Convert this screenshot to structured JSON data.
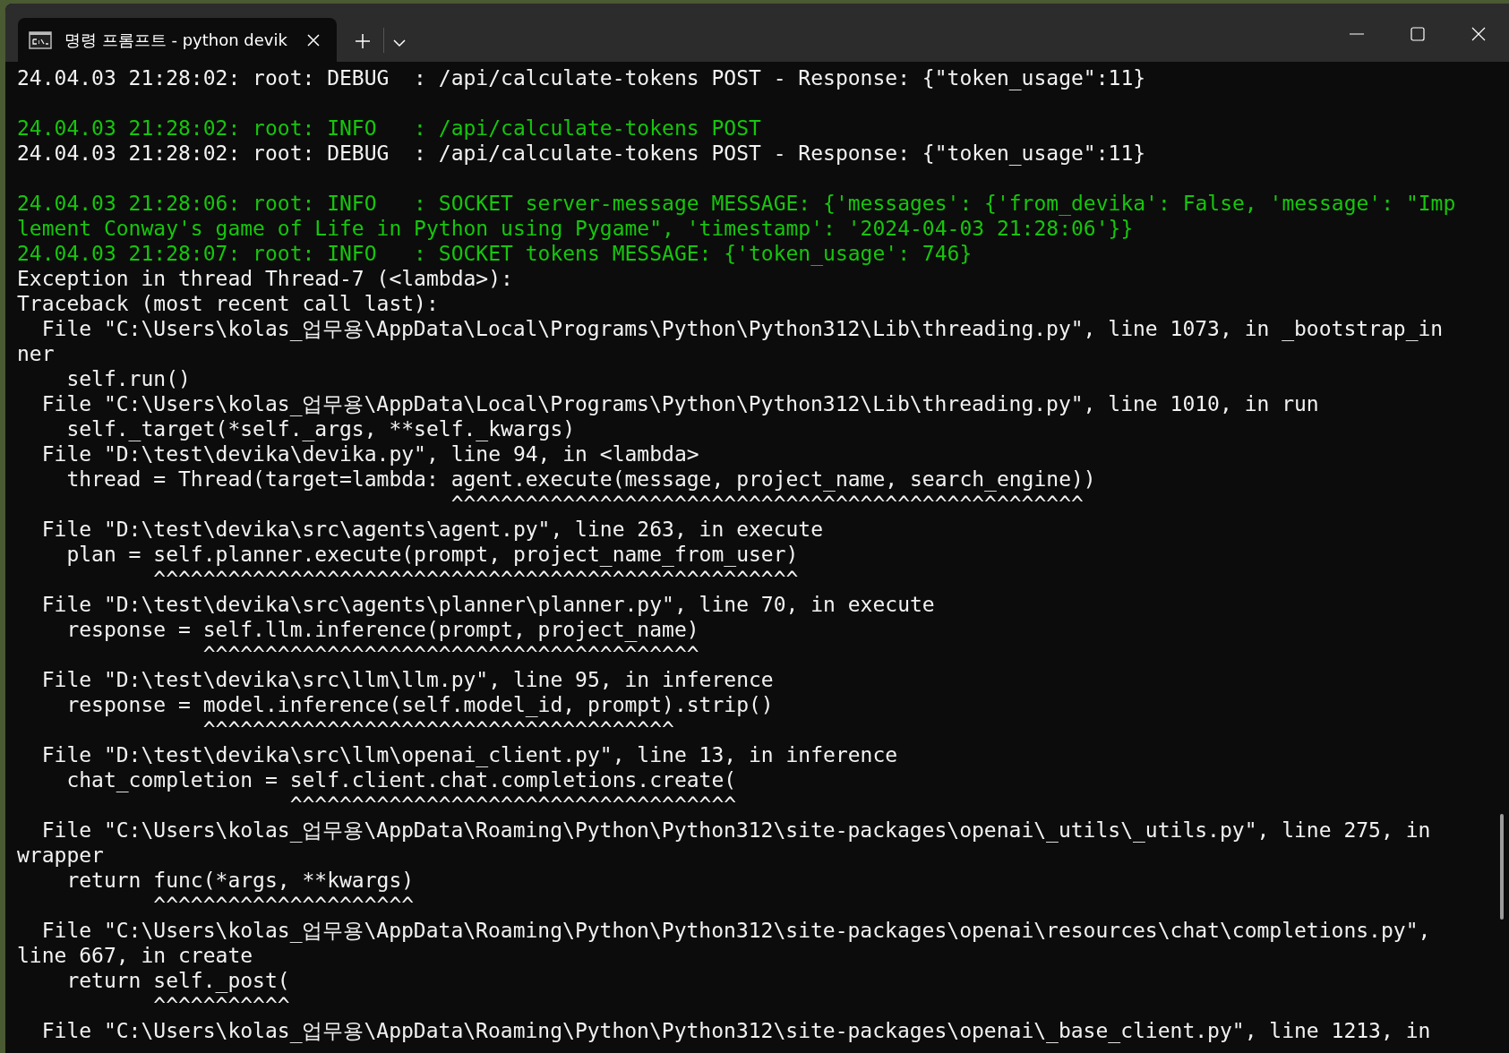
{
  "tab": {
    "title": "명령 프롬프트 - python  devik",
    "selected": true
  },
  "lines": [
    {
      "kind": "text",
      "color": "#f2f2f2",
      "text": "24.04.03 21:28:02: root: DEBUG  : /api/calculate-tokens POST - Response: {\"token_usage\":11}"
    },
    {
      "kind": "blank"
    },
    {
      "kind": "text",
      "color": "#16c60c",
      "text": "24.04.03 21:28:02: root: INFO   : /api/calculate-tokens POST"
    },
    {
      "kind": "text",
      "color": "#f2f2f2",
      "text": "24.04.03 21:28:02: root: DEBUG  : /api/calculate-tokens POST - Response: {\"token_usage\":11}"
    },
    {
      "kind": "blank"
    },
    {
      "kind": "text",
      "color": "#16c60c",
      "text": "24.04.03 21:28:06: root: INFO   : SOCKET server-message MESSAGE: {'messages': {'from_devika': False, 'message': \"Imp"
    },
    {
      "kind": "text",
      "color": "#16c60c",
      "text": "lement Conway's game of Life in Python using Pygame\", 'timestamp': '2024-04-03 21:28:06'}}"
    },
    {
      "kind": "text",
      "color": "#16c60c",
      "text": "24.04.03 21:28:07: root: INFO   : SOCKET tokens MESSAGE: {'token_usage': 746}"
    },
    {
      "kind": "text",
      "color": "#f2f2f2",
      "text": "Exception in thread Thread-7 (<lambda>):"
    },
    {
      "kind": "text",
      "color": "#f2f2f2",
      "text": "Traceback (most recent call last):"
    },
    {
      "kind": "text",
      "color": "#f2f2f2",
      "text": "  File \"C:\\Users\\kolas_업무용\\AppData\\Local\\Programs\\Python\\Python312\\Lib\\threading.py\", line 1073, in _bootstrap_in"
    },
    {
      "kind": "text",
      "color": "#f2f2f2",
      "text": "ner"
    },
    {
      "kind": "text",
      "color": "#f2f2f2",
      "text": "    self.run()"
    },
    {
      "kind": "text",
      "color": "#f2f2f2",
      "text": "  File \"C:\\Users\\kolas_업무용\\AppData\\Local\\Programs\\Python\\Python312\\Lib\\threading.py\", line 1010, in run"
    },
    {
      "kind": "text",
      "color": "#f2f2f2",
      "text": "    self._target(*self._args, **self._kwargs)"
    },
    {
      "kind": "text",
      "color": "#f2f2f2",
      "text": "  File \"D:\\test\\devika\\devika.py\", line 94, in <lambda>"
    },
    {
      "kind": "text",
      "color": "#f2f2f2",
      "text": "    thread = Thread(target=lambda: agent.execute(message, project_name, search_engine))"
    },
    {
      "kind": "text",
      "color": "#f2f2f2",
      "text": "                                   ^^^^^^^^^^^^^^^^^^^^^^^^^^^^^^^^^^^^^^^^^^^^^^^^^^^"
    },
    {
      "kind": "text",
      "color": "#f2f2f2",
      "text": "  File \"D:\\test\\devika\\src\\agents\\agent.py\", line 263, in execute"
    },
    {
      "kind": "text",
      "color": "#f2f2f2",
      "text": "    plan = self.planner.execute(prompt, project_name_from_user)"
    },
    {
      "kind": "text",
      "color": "#f2f2f2",
      "text": "           ^^^^^^^^^^^^^^^^^^^^^^^^^^^^^^^^^^^^^^^^^^^^^^^^^^^^"
    },
    {
      "kind": "text",
      "color": "#f2f2f2",
      "text": "  File \"D:\\test\\devika\\src\\agents\\planner\\planner.py\", line 70, in execute"
    },
    {
      "kind": "text",
      "color": "#f2f2f2",
      "text": "    response = self.llm.inference(prompt, project_name)"
    },
    {
      "kind": "text",
      "color": "#f2f2f2",
      "text": "               ^^^^^^^^^^^^^^^^^^^^^^^^^^^^^^^^^^^^^^^^"
    },
    {
      "kind": "text",
      "color": "#f2f2f2",
      "text": "  File \"D:\\test\\devika\\src\\llm\\llm.py\", line 95, in inference"
    },
    {
      "kind": "text",
      "color": "#f2f2f2",
      "text": "    response = model.inference(self.model_id, prompt).strip()"
    },
    {
      "kind": "text",
      "color": "#f2f2f2",
      "text": "               ^^^^^^^^^^^^^^^^^^^^^^^^^^^^^^^^^^^^^^"
    },
    {
      "kind": "text",
      "color": "#f2f2f2",
      "text": "  File \"D:\\test\\devika\\src\\llm\\openai_client.py\", line 13, in inference"
    },
    {
      "kind": "text",
      "color": "#f2f2f2",
      "text": "    chat_completion = self.client.chat.completions.create("
    },
    {
      "kind": "text",
      "color": "#f2f2f2",
      "text": "                      ^^^^^^^^^^^^^^^^^^^^^^^^^^^^^^^^^^^^"
    },
    {
      "kind": "text",
      "color": "#f2f2f2",
      "text": "  File \"C:\\Users\\kolas_업무용\\AppData\\Roaming\\Python\\Python312\\site-packages\\openai\\_utils\\_utils.py\", line 275, in"
    },
    {
      "kind": "text",
      "color": "#f2f2f2",
      "text": "wrapper"
    },
    {
      "kind": "text",
      "color": "#f2f2f2",
      "text": "    return func(*args, **kwargs)"
    },
    {
      "kind": "text",
      "color": "#f2f2f2",
      "text": "           ^^^^^^^^^^^^^^^^^^^^^"
    },
    {
      "kind": "text",
      "color": "#f2f2f2",
      "text": "  File \"C:\\Users\\kolas_업무용\\AppData\\Roaming\\Python\\Python312\\site-packages\\openai\\resources\\chat\\completions.py\","
    },
    {
      "kind": "text",
      "color": "#f2f2f2",
      "text": "line 667, in create"
    },
    {
      "kind": "text",
      "color": "#f2f2f2",
      "text": "    return self._post("
    },
    {
      "kind": "text",
      "color": "#f2f2f2",
      "text": "           ^^^^^^^^^^^"
    },
    {
      "kind": "text",
      "color": "#f2f2f2",
      "text": "  File \"C:\\Users\\kolas_업무용\\AppData\\Roaming\\Python\\Python312\\site-packages\\openai\\_base_client.py\", line 1213, in"
    }
  ]
}
